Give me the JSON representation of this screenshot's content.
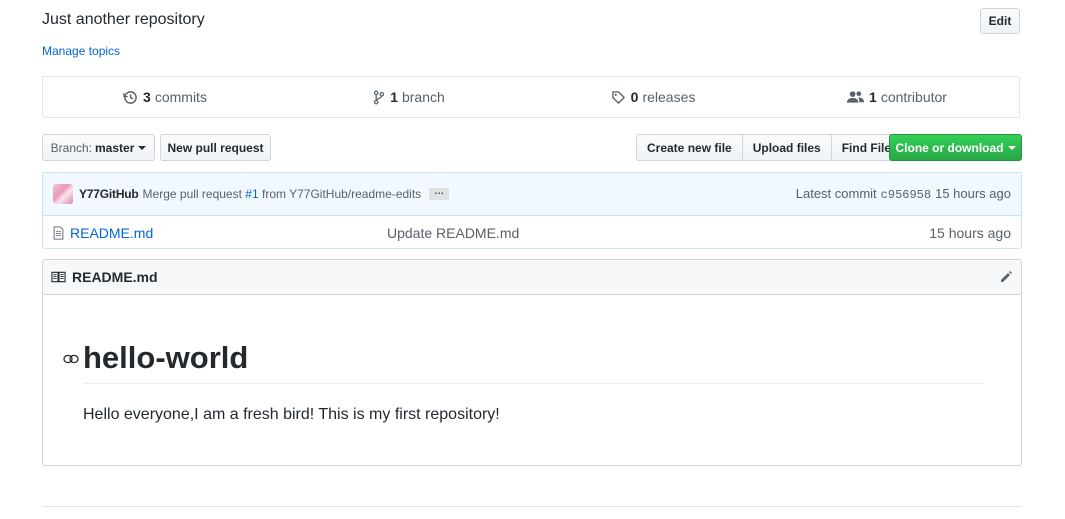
{
  "repo": {
    "description": "Just another repository",
    "manage_topics": "Manage topics",
    "edit_label": "Edit"
  },
  "summary": {
    "commits": {
      "count": "3",
      "label": "commits",
      "icon": "history-icon"
    },
    "branches": {
      "count": "1",
      "label": "branch",
      "icon": "git-branch-icon"
    },
    "releases": {
      "count": "0",
      "label": "releases",
      "icon": "tag-icon"
    },
    "contributors": {
      "count": "1",
      "label": "contributor",
      "icon": "people-icon"
    }
  },
  "toolbar": {
    "branch_label": "Branch:",
    "branch_value": "master",
    "new_pull_request": "New pull request",
    "create_new_file": "Create new file",
    "upload_files": "Upload files",
    "find_file": "Find File",
    "clone_or_download": "Clone or download"
  },
  "latest_commit": {
    "author": "Y77GitHub",
    "message_prefix": "Merge pull request",
    "pr_link": "#1",
    "message_suffix": "from Y77GitHub/readme-edits",
    "ellipsis": "…",
    "latest_label": "Latest commit",
    "sha": "c956958",
    "age": "15 hours ago"
  },
  "files": [
    {
      "name": "README.md",
      "message": "Update README.md",
      "age": "15 hours ago",
      "icon": "file-icon"
    }
  ],
  "readme": {
    "header_title": "README.md",
    "heading": "hello-world",
    "paragraph": "Hello everyone,I am a fresh bird! This is my first repository!"
  },
  "colors": {
    "link": "#0366d6",
    "primary_button": "#28a745",
    "commit_bar_bg": "#f1f8ff",
    "text": "#24292e",
    "muted": "#586069"
  }
}
